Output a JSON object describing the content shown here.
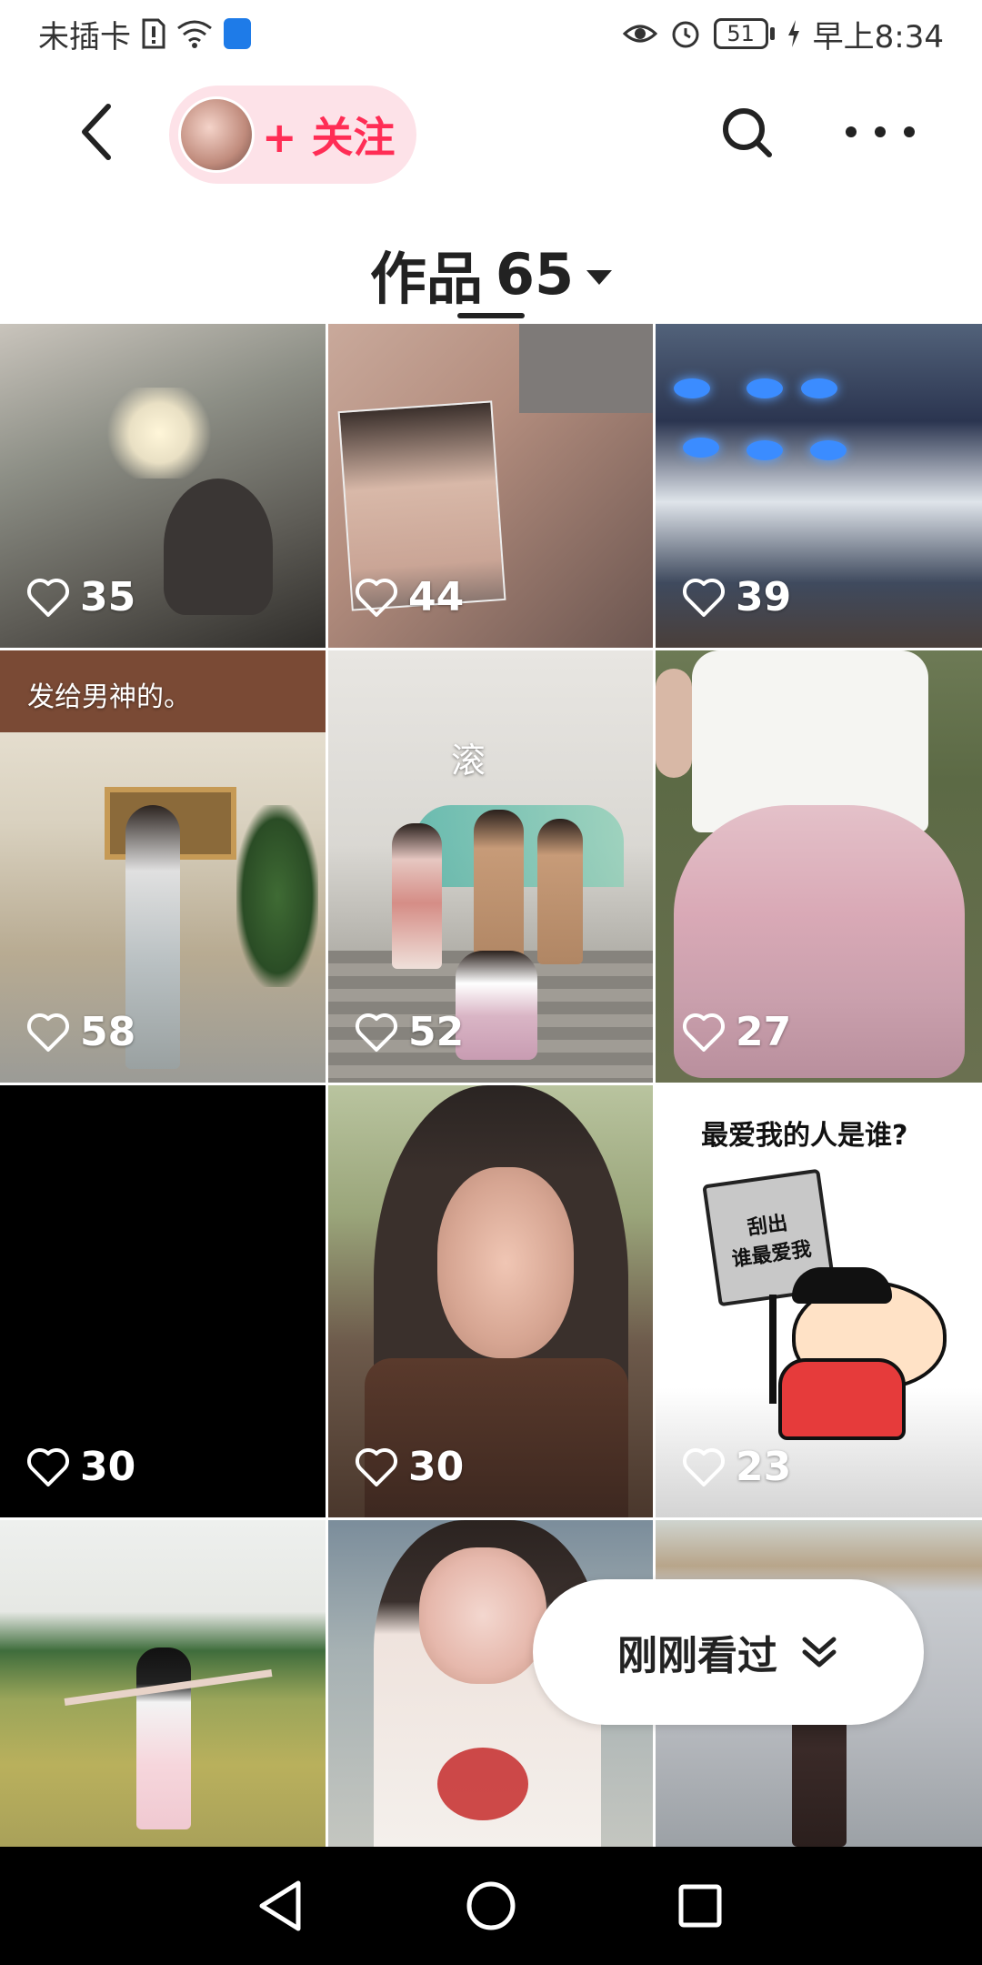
{
  "status_bar": {
    "carrier": "未插卡",
    "battery": "51",
    "time": "早上8:34"
  },
  "nav": {
    "follow_label": "+ 关注"
  },
  "works": {
    "label": "作品",
    "count": "65"
  },
  "tiles": [
    {
      "likes": "35",
      "caption": ""
    },
    {
      "likes": "44",
      "caption": ""
    },
    {
      "likes": "39",
      "caption": ""
    },
    {
      "likes": "58",
      "caption": "发给男神的。"
    },
    {
      "likes": "52",
      "caption": "滚"
    },
    {
      "likes": "27",
      "caption": ""
    },
    {
      "likes": "30",
      "caption": ""
    },
    {
      "likes": "30",
      "caption": ""
    },
    {
      "likes": "23",
      "caption": "最爱我的人是谁?",
      "sign": "刮出\n谁最爱我"
    },
    {
      "likes": "",
      "caption": ""
    },
    {
      "likes": "",
      "caption": ""
    },
    {
      "likes": "",
      "caption": ""
    }
  ],
  "recent": {
    "label": "刚刚看过"
  },
  "colors": {
    "accent": "#ff2d55",
    "pill_bg": "#fde2e8"
  }
}
